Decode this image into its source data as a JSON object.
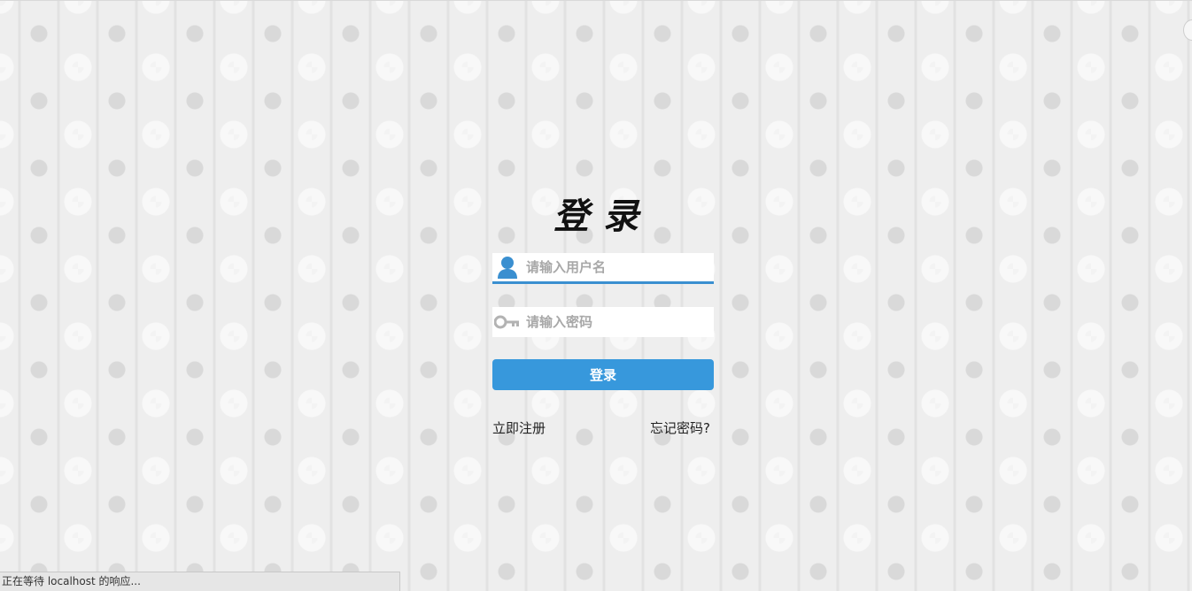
{
  "login": {
    "title": "登录",
    "username": {
      "placeholder": "请输入用户名",
      "icon": "user-icon",
      "value": ""
    },
    "password": {
      "placeholder": "请输入密码",
      "icon": "key-icon",
      "value": ""
    },
    "submit_label": "登录",
    "register_link": "立即注册",
    "forgot_link": "忘记密码?"
  },
  "colors": {
    "accent": "#3798dc",
    "underline": "#3a8fd0",
    "icon_user": "#3a8fd0",
    "icon_key": "#b3b3b3"
  },
  "browser": {
    "status_text": "正在等待 localhost 的响应..."
  }
}
